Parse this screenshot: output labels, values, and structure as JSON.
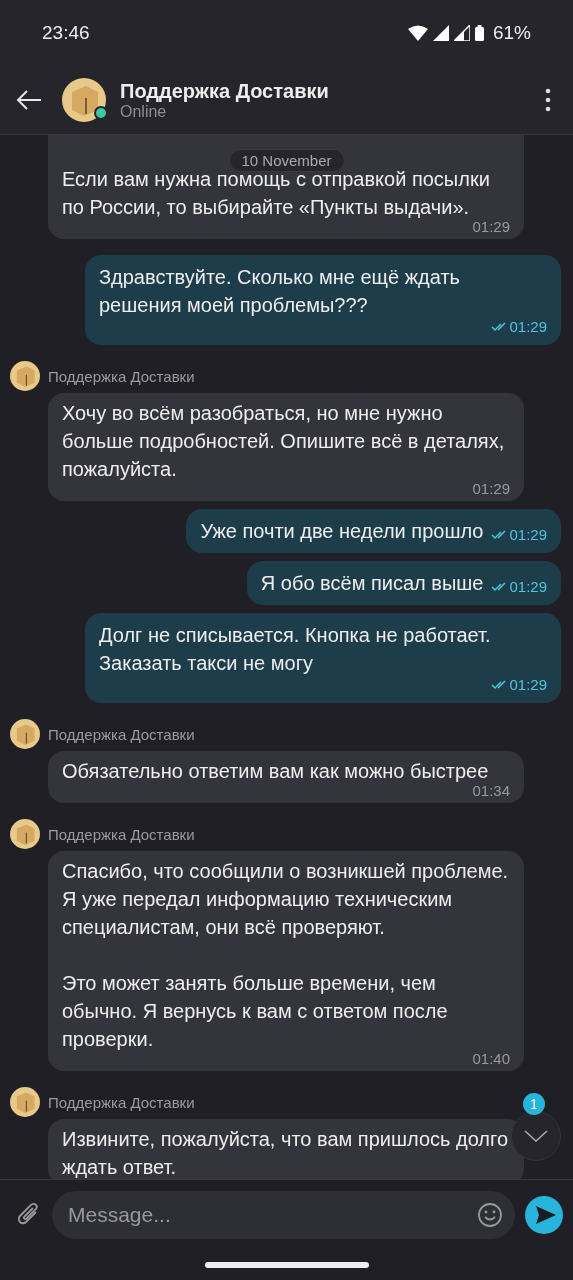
{
  "status_bar": {
    "time": "23:46",
    "battery": "61%"
  },
  "header": {
    "title": "Поддержка Доставки",
    "status": "Online",
    "online": true
  },
  "date_chip": "10 November",
  "messages": [
    {
      "kind": "incoming",
      "text": "Если вам нужна помощь с отправкой посылки по России, то выбирайте «Пункты выдачи».",
      "time": "01:29"
    },
    {
      "kind": "outgoing",
      "text": "Здравствуйте. Сколько мне ещё ждать решения моей проблемы???",
      "time": "01:29",
      "read": true
    },
    {
      "kind": "incoming",
      "sender": "Поддержка Доставки",
      "text": "Хочу во всём разобраться, но мне нужно больше подробностей. Опишите всё в деталях, пожалуйста.",
      "time": "01:29"
    },
    {
      "kind": "outgoing",
      "text": "Уже почти две недели прошло",
      "time": "01:29",
      "read": true
    },
    {
      "kind": "outgoing",
      "text": "Я обо всём писал выше",
      "time": "01:29",
      "read": true
    },
    {
      "kind": "outgoing",
      "text": "Долг не списывается. Кнопка не работает. Заказать такси не могу",
      "time": "01:29",
      "read": true
    },
    {
      "kind": "incoming",
      "sender": "Поддержка Доставки",
      "text": "Обязательно ответим вам как можно быстрее",
      "time": "01:34"
    },
    {
      "kind": "incoming",
      "sender": "Поддержка Доставки",
      "text": "Спасибо, что сообщили о возникшей проблеме. Я уже передал информацию техническим специалистам, они всё проверяют.\n\nЭто может занять больше времени, чем обычно. Я вернусь к вам с ответом после проверки.",
      "time": "01:40"
    },
    {
      "kind": "incoming",
      "sender": "Поддержка Доставки",
      "text": "Извините, пожалуйста, что вам пришлось долго ждать ответ."
    }
  ],
  "unread_badge": "1",
  "composer": {
    "placeholder": "Message..."
  }
}
